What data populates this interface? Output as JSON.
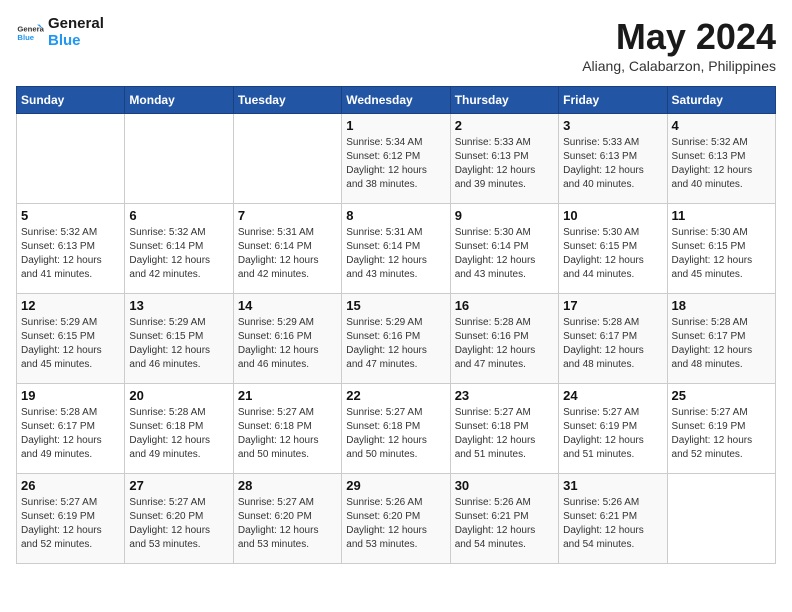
{
  "header": {
    "logo_general": "General",
    "logo_blue": "Blue",
    "month_title": "May 2024",
    "location": "Aliang, Calabarzon, Philippines"
  },
  "weekdays": [
    "Sunday",
    "Monday",
    "Tuesday",
    "Wednesday",
    "Thursday",
    "Friday",
    "Saturday"
  ],
  "weeks": [
    [
      {
        "day": "",
        "info": ""
      },
      {
        "day": "",
        "info": ""
      },
      {
        "day": "",
        "info": ""
      },
      {
        "day": "1",
        "info": "Sunrise: 5:34 AM\nSunset: 6:12 PM\nDaylight: 12 hours\nand 38 minutes."
      },
      {
        "day": "2",
        "info": "Sunrise: 5:33 AM\nSunset: 6:13 PM\nDaylight: 12 hours\nand 39 minutes."
      },
      {
        "day": "3",
        "info": "Sunrise: 5:33 AM\nSunset: 6:13 PM\nDaylight: 12 hours\nand 40 minutes."
      },
      {
        "day": "4",
        "info": "Sunrise: 5:32 AM\nSunset: 6:13 PM\nDaylight: 12 hours\nand 40 minutes."
      }
    ],
    [
      {
        "day": "5",
        "info": "Sunrise: 5:32 AM\nSunset: 6:13 PM\nDaylight: 12 hours\nand 41 minutes."
      },
      {
        "day": "6",
        "info": "Sunrise: 5:32 AM\nSunset: 6:14 PM\nDaylight: 12 hours\nand 42 minutes."
      },
      {
        "day": "7",
        "info": "Sunrise: 5:31 AM\nSunset: 6:14 PM\nDaylight: 12 hours\nand 42 minutes."
      },
      {
        "day": "8",
        "info": "Sunrise: 5:31 AM\nSunset: 6:14 PM\nDaylight: 12 hours\nand 43 minutes."
      },
      {
        "day": "9",
        "info": "Sunrise: 5:30 AM\nSunset: 6:14 PM\nDaylight: 12 hours\nand 43 minutes."
      },
      {
        "day": "10",
        "info": "Sunrise: 5:30 AM\nSunset: 6:15 PM\nDaylight: 12 hours\nand 44 minutes."
      },
      {
        "day": "11",
        "info": "Sunrise: 5:30 AM\nSunset: 6:15 PM\nDaylight: 12 hours\nand 45 minutes."
      }
    ],
    [
      {
        "day": "12",
        "info": "Sunrise: 5:29 AM\nSunset: 6:15 PM\nDaylight: 12 hours\nand 45 minutes."
      },
      {
        "day": "13",
        "info": "Sunrise: 5:29 AM\nSunset: 6:15 PM\nDaylight: 12 hours\nand 46 minutes."
      },
      {
        "day": "14",
        "info": "Sunrise: 5:29 AM\nSunset: 6:16 PM\nDaylight: 12 hours\nand 46 minutes."
      },
      {
        "day": "15",
        "info": "Sunrise: 5:29 AM\nSunset: 6:16 PM\nDaylight: 12 hours\nand 47 minutes."
      },
      {
        "day": "16",
        "info": "Sunrise: 5:28 AM\nSunset: 6:16 PM\nDaylight: 12 hours\nand 47 minutes."
      },
      {
        "day": "17",
        "info": "Sunrise: 5:28 AM\nSunset: 6:17 PM\nDaylight: 12 hours\nand 48 minutes."
      },
      {
        "day": "18",
        "info": "Sunrise: 5:28 AM\nSunset: 6:17 PM\nDaylight: 12 hours\nand 48 minutes."
      }
    ],
    [
      {
        "day": "19",
        "info": "Sunrise: 5:28 AM\nSunset: 6:17 PM\nDaylight: 12 hours\nand 49 minutes."
      },
      {
        "day": "20",
        "info": "Sunrise: 5:28 AM\nSunset: 6:18 PM\nDaylight: 12 hours\nand 49 minutes."
      },
      {
        "day": "21",
        "info": "Sunrise: 5:27 AM\nSunset: 6:18 PM\nDaylight: 12 hours\nand 50 minutes."
      },
      {
        "day": "22",
        "info": "Sunrise: 5:27 AM\nSunset: 6:18 PM\nDaylight: 12 hours\nand 50 minutes."
      },
      {
        "day": "23",
        "info": "Sunrise: 5:27 AM\nSunset: 6:18 PM\nDaylight: 12 hours\nand 51 minutes."
      },
      {
        "day": "24",
        "info": "Sunrise: 5:27 AM\nSunset: 6:19 PM\nDaylight: 12 hours\nand 51 minutes."
      },
      {
        "day": "25",
        "info": "Sunrise: 5:27 AM\nSunset: 6:19 PM\nDaylight: 12 hours\nand 52 minutes."
      }
    ],
    [
      {
        "day": "26",
        "info": "Sunrise: 5:27 AM\nSunset: 6:19 PM\nDaylight: 12 hours\nand 52 minutes."
      },
      {
        "day": "27",
        "info": "Sunrise: 5:27 AM\nSunset: 6:20 PM\nDaylight: 12 hours\nand 53 minutes."
      },
      {
        "day": "28",
        "info": "Sunrise: 5:27 AM\nSunset: 6:20 PM\nDaylight: 12 hours\nand 53 minutes."
      },
      {
        "day": "29",
        "info": "Sunrise: 5:26 AM\nSunset: 6:20 PM\nDaylight: 12 hours\nand 53 minutes."
      },
      {
        "day": "30",
        "info": "Sunrise: 5:26 AM\nSunset: 6:21 PM\nDaylight: 12 hours\nand 54 minutes."
      },
      {
        "day": "31",
        "info": "Sunrise: 5:26 AM\nSunset: 6:21 PM\nDaylight: 12 hours\nand 54 minutes."
      },
      {
        "day": "",
        "info": ""
      }
    ]
  ]
}
